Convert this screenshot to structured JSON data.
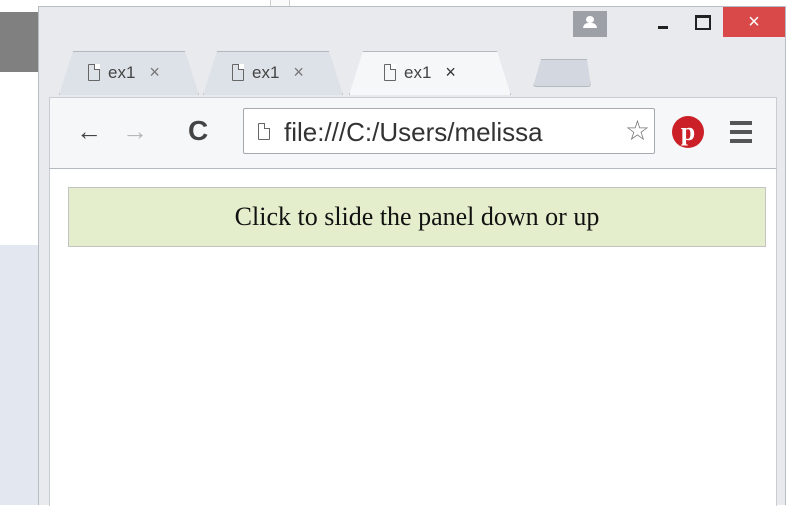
{
  "window": {
    "caption": {
      "close_glyph": "×"
    }
  },
  "tabs": [
    {
      "label": "ex1",
      "close_glyph": "×",
      "active": false
    },
    {
      "label": "ex1",
      "close_glyph": "×",
      "active": false
    },
    {
      "label": "ex1",
      "close_glyph": "×",
      "active": true
    }
  ],
  "toolbar": {
    "back_glyph": "←",
    "forward_glyph": "→",
    "reload_glyph": "C",
    "url": "file:///C:/Users/melissa",
    "bookmark_glyph": "☆",
    "extension_glyph": "p"
  },
  "page": {
    "flip_text": "Click to slide the panel down or up"
  },
  "colors": {
    "flip_background": "#e5eecc",
    "close_button": "#d9494a",
    "pinterest": "#cb2027"
  }
}
